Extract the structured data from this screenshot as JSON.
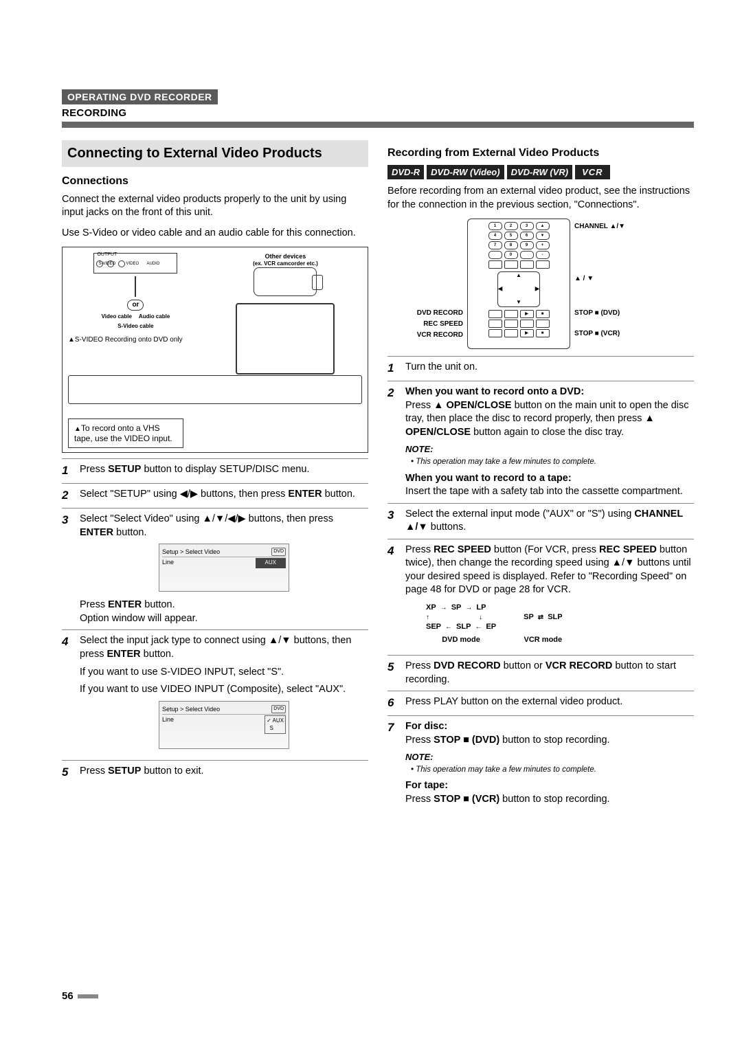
{
  "header": {
    "section_tag": "OPERATING DVD RECORDER",
    "sub_title": "RECORDING"
  },
  "left": {
    "big_heading": "Connecting to External Video Products",
    "connections_heading": "Connections",
    "p1": "Connect the external video products properly to the unit by using input jacks on the front of this unit.",
    "p2": "Use S-Video or video cable and an audio cable for this connection.",
    "diagram": {
      "output": "OUTPUT",
      "svideo": "S-VIDEO",
      "video": "VIDEO",
      "audio": "AUDIO",
      "other": "Other devices",
      "other2": "(ex. VCR camcorder etc.)",
      "or": "or",
      "video_cable": "Video cable",
      "audio_cable": "Audio cable",
      "svideo_cable": "S-Video cable",
      "svideo_note": "S-VIDEO Recording onto DVD only",
      "caution": "To record onto a VHS tape, use the VIDEO input."
    },
    "steps": {
      "s1": "Press SETUP button to display SETUP/DISC menu.",
      "s2": "Select \"SETUP\" using ◀/▶ buttons, then press ENTER button.",
      "s3": "Select \"Select Video\" using ▲/▼/◀/▶ buttons, then press ENTER button.",
      "osd1_title": "Setup > Select Video",
      "osd1_tag": "DVD",
      "osd1_row_l": "Line",
      "osd1_row_r": "AUX",
      "s3b": "Press ENTER button.",
      "s3c": "Option window will appear.",
      "s4a": "Select the input jack type to connect using ▲/▼ buttons, then press ENTER button.",
      "s4b": "If you want to use S-VIDEO INPUT, select \"S\".",
      "s4c": "If you want to use VIDEO INPUT (Composite), select \"AUX\".",
      "osd2_title": "Setup > Select Video",
      "osd2_tag": "DVD",
      "osd2_row_l": "Line",
      "osd2_opt1": "AUX",
      "osd2_opt2": "S",
      "s5": "Press SETUP button to exit."
    }
  },
  "right": {
    "heading": "Recording from External Video Products",
    "badges": {
      "a": "DVD-R",
      "b": "DVD-RW (Video)",
      "c": "DVD-RW (VR)",
      "d": "VCR"
    },
    "p1": "Before recording from an external video product, see the instructions for the connection in the previous section, \"Connections\".",
    "remote_labels": {
      "channel": "CHANNEL ▲/▼",
      "updown": "▲ / ▼",
      "dvd_record": "DVD RECORD",
      "rec_speed": "REC SPEED",
      "vcr_record": "VCR RECORD",
      "stop_dvd": "STOP ■ (DVD)",
      "stop_vcr": "STOP ■ (VCR)"
    },
    "steps": {
      "s1": "Turn the unit on.",
      "s2h": "When you want to record onto a DVD:",
      "s2": "Press ▲ OPEN/CLOSE button on the main unit to open the disc tray, then place the disc to record properly, then press ▲ OPEN/CLOSE button again to close the disc tray.",
      "note_lbl": "NOTE:",
      "note1": "• This operation may take a few minutes to complete.",
      "s2th": "When you want to record to a tape:",
      "s2t": "Insert the tape with a safety tab into the cassette compartment.",
      "s3": "Select the external input mode (\"AUX\" or \"S\") using CHANNEL ▲/▼ buttons.",
      "s4": "Press REC SPEED button (For VCR, press REC SPEED button twice), then change the recording speed using ▲/▼ buttons until your desired speed is displayed. Refer to \"Recording Speed\" on page 48 for DVD or page 28 for VCR.",
      "speed": {
        "xp": "XP",
        "sp": "SP",
        "lp": "LP",
        "sep": "SEP",
        "slp": "SLP",
        "ep": "EP",
        "dvd_mode": "DVD mode",
        "vcr_mode": "VCR mode",
        "sp2": "SP",
        "slp2": "SLP"
      },
      "s5": "Press DVD RECORD button or VCR RECORD button to start recording.",
      "s6": "Press PLAY button on the external video product.",
      "s7h": "For disc:",
      "s7": "Press STOP ■ (DVD) button to stop recording.",
      "note2": "• This operation may take a few minutes to complete.",
      "s7th": "For tape:",
      "s7t": "Press STOP ■ (VCR) button to stop recording."
    }
  },
  "footer": {
    "page": "56"
  }
}
